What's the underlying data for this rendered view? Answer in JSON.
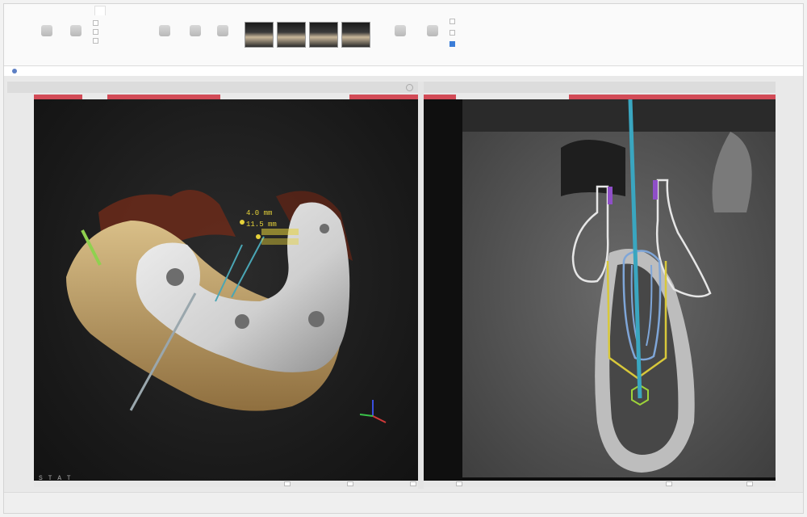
{
  "ribbon": {
    "tabs": [
      "",
      "",
      ""
    ],
    "buttons": [
      "",
      "",
      "",
      "",
      "",
      ""
    ],
    "checks": [
      "",
      "",
      ""
    ],
    "right_checks": [
      "",
      "",
      ""
    ],
    "thumbnails": 4,
    "groups": [
      "",
      "",
      "",
      ""
    ]
  },
  "infobar": {
    "message": "",
    "link": ""
  },
  "views": {
    "left_header": "",
    "right_header": ""
  },
  "view3d": {
    "measure_1": "4.0 mm",
    "measure_2": "11.5 mm",
    "corner_label": "S T A T"
  },
  "colors": {
    "accent_red": "#d24b57",
    "implant_blue": "#4aa6b5",
    "outline_yellow": "#d8c83a",
    "outline_lightblue": "#7fa6d8",
    "nerve_purple": "#8f4fc8"
  }
}
